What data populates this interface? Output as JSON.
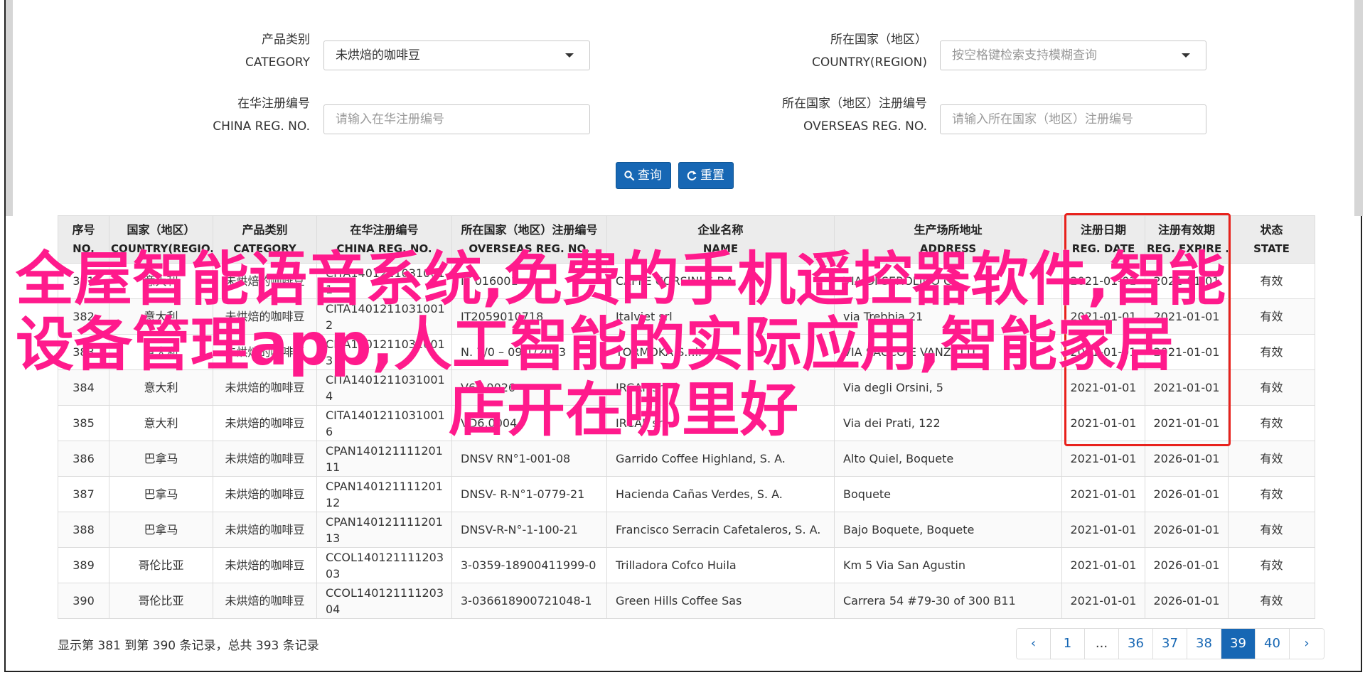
{
  "filters": {
    "category": {
      "label_cn": "产品类别",
      "label_en": "CATEGORY",
      "value": "未烘焙的咖啡豆"
    },
    "country": {
      "label_cn": "所在国家（地区）",
      "label_en": "COUNTRY(REGION)",
      "placeholder": "按空格键检索支持模糊查询"
    },
    "china_reg": {
      "label_cn": "在华注册编号",
      "label_en": "CHINA REG. NO.",
      "placeholder": "请输入在华注册编号"
    },
    "overseas_reg": {
      "label_cn": "所在国家（地区）注册编号",
      "label_en": "OVERSEAS REG. NO.",
      "placeholder": "请输入所在国家（地区）注册编号"
    },
    "search_label": "查询",
    "reset_label": "重置"
  },
  "table": {
    "headers": [
      {
        "cn": "序号",
        "en": "NO."
      },
      {
        "cn": "国家（地区）",
        "en": "COUNTRY(REGIO..."
      },
      {
        "cn": "产品类别",
        "en": "CATEGORY"
      },
      {
        "cn": "在华注册编号",
        "en": "CHINA REG. NO."
      },
      {
        "cn": "所在国家（地区）注册编号",
        "en": "OVERSEAS REG. NO."
      },
      {
        "cn": "企业名称",
        "en": "NAME"
      },
      {
        "cn": "生产场所地址",
        "en": "ADDRESS"
      },
      {
        "cn": "注册日期",
        "en": "REG. DATE"
      },
      {
        "cn": "注册有效期",
        "en": "REG. EXPIRE ..."
      },
      {
        "cn": "状态",
        "en": "STATE"
      }
    ],
    "rows": [
      [
        "381",
        "意大利",
        "未烘焙的咖啡豆",
        "CITA14012110310011",
        "IT 016001",
        "CAFFE CORSINI S.P.A.",
        "VIA DI SEROLINO C...",
        "2021-01-01",
        "2021-01-01",
        "有效"
      ],
      [
        "382",
        "意大利",
        "未烘焙的咖啡豆",
        "CITA14012110310012",
        "IT2059010718",
        "Italviet srl",
        "via Trebbia 21",
        "2021-01-01",
        "2021-01-01",
        "有效"
      ],
      [
        "383",
        "意大利",
        "未烘焙的咖啡豆",
        "CITA14012110310013",
        "N. 7/0 – 09/1/2003",
        "TORMOKA S.r.l.",
        "VIA SACCO E VANZETTI",
        "2021-01-01",
        "2021-01-01",
        "有效"
      ],
      [
        "384",
        "意大利",
        "未烘焙的咖啡豆",
        "CITA14012110310014",
        "V69.0026",
        "IRCAF srl",
        "Via degli Orsini, 5",
        "2021-01-01",
        "2021-01-01",
        "有效"
      ],
      [
        "385",
        "意大利",
        "未烘焙的咖啡豆",
        "CITA14012110310016",
        "VD6.0004",
        "IRCAF srl",
        "Via dei Prati, 122",
        "2021-01-01",
        "2021-01-01",
        "有效"
      ],
      [
        "386",
        "巴拿马",
        "未烘焙的咖啡豆",
        "CPAN14012111120111",
        "DNSV RN°1-001-08",
        "Garrido Coffee Highland, S. A.",
        "Alto Quiel, Boquete",
        "2021-01-01",
        "2026-01-01",
        "有效"
      ],
      [
        "387",
        "巴拿马",
        "未烘焙的咖啡豆",
        "CPAN14012111120112",
        "DNSV- R-N°1-0779-21",
        "Hacienda Cañas Verdes, S. A.",
        "Boquete",
        "2021-01-01",
        "2026-01-01",
        "有效"
      ],
      [
        "388",
        "巴拿马",
        "未烘焙的咖啡豆",
        "CPAN14012111120113",
        "DNSV-R-N°-1-100-21",
        "Francisco Serracin Cafetaleros, S. A.",
        "Bajo Boquete, Boquete",
        "2021-01-01",
        "2026-01-01",
        "有效"
      ],
      [
        "389",
        "哥伦比亚",
        "未烘焙的咖啡豆",
        "CCOL14012111120303",
        "3-0359-18900411999-0",
        "Trilladora Cofco Huila",
        "Km 5 Via San Agustin",
        "2021-01-01",
        "2026-01-01",
        "有效"
      ],
      [
        "390",
        "哥伦比亚",
        "未烘焙的咖啡豆",
        "CCOL14012111120304",
        "3-036618900721048-1",
        "Green Hills Coffee Sas",
        "Carrera 54 #79-30 of 300 B11",
        "2021-01-01",
        "2026-01-01",
        "有效"
      ]
    ]
  },
  "overlay": {
    "line1": "全屋智能语音系统,免费的手机遥控器软件,智能",
    "line2": "设备管理app,人工智能的实际应用,智能家居",
    "line3": "店开在哪里好"
  },
  "summary": "显示第 381 到第 390 条记录，总共 393 条记录",
  "pagination": {
    "prev": "‹",
    "items": [
      "1",
      "...",
      "36",
      "37",
      "38",
      "39",
      "40"
    ],
    "active": "39",
    "next": "›"
  },
  "colors": {
    "primary": "#1767b4",
    "highlight": "#e8211c",
    "overlay_text": "#ff1a8c"
  }
}
